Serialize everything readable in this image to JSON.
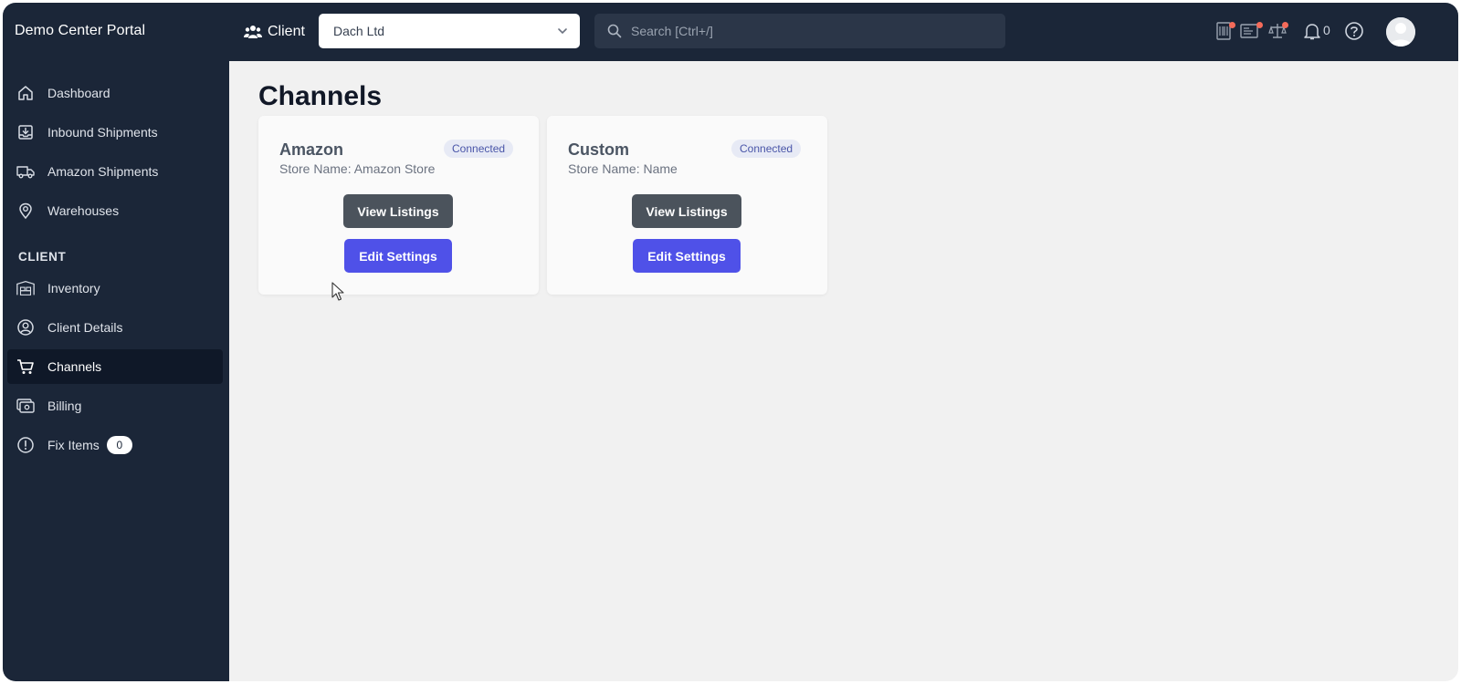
{
  "header": {
    "brand": "Demo Center Portal",
    "client_label": "Client",
    "client_select": {
      "value": "Dach Ltd"
    },
    "search": {
      "placeholder": "Search [Ctrl+/]"
    },
    "notification_count": "0",
    "icons": [
      "barcode-icon",
      "label-icon",
      "scale-icon",
      "bell-icon",
      "help-icon",
      "user-avatar"
    ],
    "alert_dot_color": "#f56b5a"
  },
  "sidebar": {
    "items": [
      {
        "label": "Dashboard",
        "icon": "home-icon"
      },
      {
        "label": "Inbound Shipments",
        "icon": "inbox-download-icon"
      },
      {
        "label": "Amazon Shipments",
        "icon": "truck-icon"
      },
      {
        "label": "Warehouses",
        "icon": "map-pin-icon"
      }
    ],
    "section_label": "CLIENT",
    "client_items": [
      {
        "label": "Inventory",
        "icon": "warehouse-shelf-icon"
      },
      {
        "label": "Client Details",
        "icon": "user-circle-icon"
      },
      {
        "label": "Channels",
        "icon": "cart-icon",
        "active": true
      },
      {
        "label": "Billing",
        "icon": "billing-icon"
      },
      {
        "label": "Fix Items",
        "icon": "alert-circle-icon",
        "count": "0"
      }
    ]
  },
  "main": {
    "title": "Channels",
    "channels": [
      {
        "name": "Amazon",
        "store_name": "Store Name: Amazon Store",
        "status": "Connected",
        "view_label": "View Listings",
        "edit_label": "Edit Settings"
      },
      {
        "name": "Custom",
        "store_name": "Store Name: Name",
        "status": "Connected",
        "view_label": "View Listings",
        "edit_label": "Edit Settings"
      }
    ]
  },
  "colors": {
    "sidebar_bg": "#1b2638",
    "active_item_bg": "#0f1828",
    "primary_button": "#4f51e8",
    "secondary_button": "#4b535c",
    "badge_bg": "#e7eaf5",
    "badge_text": "#4955a8"
  }
}
